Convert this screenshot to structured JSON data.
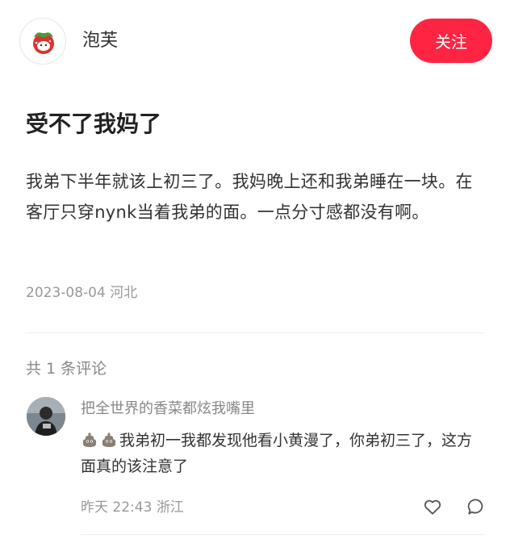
{
  "author": {
    "name": "泡芙",
    "avatar_icon": "strawberry-character-icon"
  },
  "header": {
    "follow_label": "关注",
    "follow_color": "#ff2442"
  },
  "post": {
    "title": "受不了我妈了",
    "content": "我弟下半年就该上初三了。我妈晚上还和我弟睡在一块。在客厅只穿nynk当着我弟的面。一点分寸感都没有啊。",
    "date": "2023-08-04",
    "location": "河北"
  },
  "comments": {
    "count_label": "共 1 条评论",
    "items": [
      {
        "user": "把全世界的香菜都炫我嘴里",
        "emoji_icons": [
          "poop-emoji-icon",
          "poop-emoji-icon"
        ],
        "text": "我弟初一我都发现他看小黄漫了，你弟初三了，这方面真的该注意了",
        "time": "昨天 22:43",
        "location": "浙江"
      }
    ]
  }
}
